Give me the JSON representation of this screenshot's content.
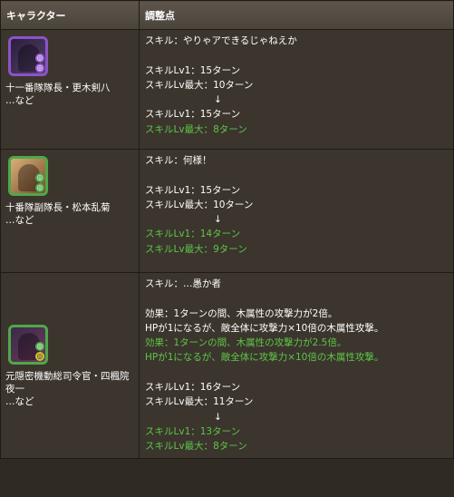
{
  "headers": {
    "character": "キャラクター",
    "adjustment": "調整点"
  },
  "rows": [
    {
      "name": "十一番隊隊長・更木剣八",
      "suffix": "…など",
      "skill": "スキル：やりゃアできるじゃねえか",
      "before": [
        "スキルLv1：15ターン",
        "スキルLv最大：10ターン"
      ],
      "arrow": "↓",
      "after": [
        "スキルLv1：15ターン",
        "スキルLv最大：8ターン"
      ]
    },
    {
      "name": "十番隊副隊長・松本乱菊",
      "suffix": "…など",
      "skill": "スキル：何様！",
      "before": [
        "スキルLv1：15ターン",
        "スキルLv最大：10ターン"
      ],
      "arrow": "↓",
      "after": [
        "スキルLv1：14ターン",
        "スキルLv最大：9ターン"
      ]
    },
    {
      "name": "元隠密機動総司令官・四楓院夜一",
      "suffix": "…など",
      "skill": "スキル：…愚か者",
      "effect_before": [
        "効果：1ターンの間、木属性の攻撃力が2倍。",
        "HPが1になるが、敵全体に攻撃力×10倍の木属性攻撃。"
      ],
      "effect_after": [
        "効果：1ターンの間、木属性の攻撃力が2.5倍。",
        "HPが1になるが、敵全体に攻撃力×10倍の木属性攻撃。"
      ],
      "before": [
        "スキルLv1：16ターン",
        "スキルLv最大：11ターン"
      ],
      "arrow": "↓",
      "after": [
        "スキルLv1：13ターン",
        "スキルLv最大：8ターン"
      ]
    }
  ]
}
